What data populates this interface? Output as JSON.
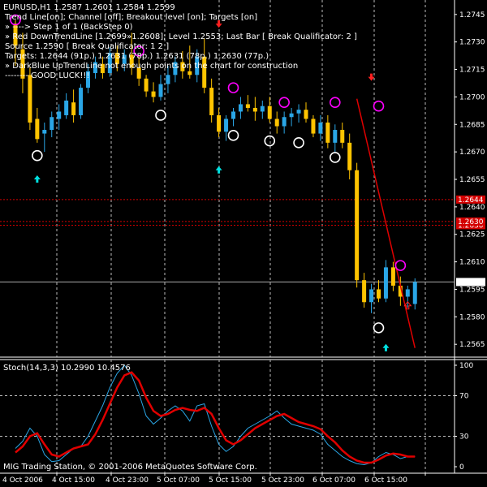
{
  "header": {
    "symbol_line": "EURUSD,H1  1.2587 1.2601 1.2584 1.2599",
    "status_line": "Trend Line[on]; Channel [off]; Breakout level [on]; Targets [on]",
    "lines": [
      "» ----> Step 1 of 1 (BackStep 0)",
      "» Red DownTrendLine [1.2699»1.2608]; Level 1.2553; Last Bar [ Break Qualificator: 2 ]",
      "Source 1.2590 [ Break Qualificator: 1 2 ]",
      "Targets: 1.2644 (91p.) 1.2631 (78p.) 1.2631 (78p.) 1.2630 (77p.)",
      "» DarkBlue UpTrendLine not enough points on the chart for construction",
      "-------- GOOD LUCK!!!"
    ]
  },
  "price_axis": {
    "ticks": [
      "1.2745",
      "1.2730",
      "1.2715",
      "1.2700",
      "1.2685",
      "1.2670",
      "1.2655",
      "1.2640",
      "1.2625",
      "1.2610",
      "1.2595",
      "1.2580",
      "1.2565"
    ],
    "levels": [
      {
        "label": "1.2644",
        "value": 1.2644,
        "color": "#d40000"
      },
      {
        "label": "1.2630",
        "value": 1.263,
        "color": "#d40000"
      },
      {
        "label": "1.2630",
        "value": 1.2632,
        "color": "#d40000"
      }
    ],
    "current": {
      "label": "1.2599",
      "value": 1.2599
    }
  },
  "time_axis": {
    "labels": [
      "4 Oct 2006",
      "4 Oct 15:00",
      "4 Oct 23:00",
      "5 Oct 07:00",
      "5 Oct 15:00",
      "5 Oct 23:00",
      "6 Oct 07:00",
      "6 Oct 15:00"
    ]
  },
  "indicator": {
    "title": "Stoch(14,3,3) 10.2990 10.4576",
    "ticks": [
      "100",
      "70",
      "30",
      "0"
    ],
    "footer": "MIG Trading Station, © 2001-2006 MetaQuotes Software Corp."
  },
  "colors": {
    "bull": "#2aa6e6",
    "bear": "#ffc400",
    "trendline": "#e00000",
    "circle_low": "#ffffff",
    "circle_high": "#ff00ff",
    "arrow_up": "#00e0e0",
    "arrow_down": "#ff2020",
    "stoch_main": "#2aa6e6",
    "stoch_signal": "#e00000"
  },
  "chart_data": {
    "type": "candlestick",
    "symbol": "EURUSD",
    "timeframe": "H1",
    "ylim": [
      1.2558,
      1.2752
    ],
    "candles": [
      [
        1.274,
        1.2742,
        1.2717,
        1.2728
      ],
      [
        1.2726,
        1.2735,
        1.2702,
        1.271
      ],
      [
        1.2712,
        1.2716,
        1.2682,
        1.2686
      ],
      [
        1.2688,
        1.2694,
        1.2675,
        1.2677
      ],
      [
        1.268,
        1.2686,
        1.267,
        1.2682
      ],
      [
        1.2682,
        1.2692,
        1.2678,
        1.2689
      ],
      [
        1.2688,
        1.2696,
        1.2682,
        1.2692
      ],
      [
        1.269,
        1.2702,
        1.2688,
        1.2698
      ],
      [
        1.2697,
        1.2704,
        1.2686,
        1.269
      ],
      [
        1.269,
        1.2707,
        1.2688,
        1.2705
      ],
      [
        1.2705,
        1.2718,
        1.2702,
        1.2714
      ],
      [
        1.2713,
        1.2722,
        1.271,
        1.2719
      ],
      [
        1.2718,
        1.2722,
        1.271,
        1.2713
      ],
      [
        1.2713,
        1.2727,
        1.2711,
        1.2724
      ],
      [
        1.2724,
        1.2728,
        1.2714,
        1.2718
      ],
      [
        1.2718,
        1.2726,
        1.2714,
        1.2723
      ],
      [
        1.2723,
        1.2735,
        1.2712,
        1.2716
      ],
      [
        1.2716,
        1.2722,
        1.2706,
        1.271
      ],
      [
        1.271,
        1.2712,
        1.27,
        1.2703
      ],
      [
        1.2703,
        1.2708,
        1.2697,
        1.27
      ],
      [
        1.27,
        1.2712,
        1.2698,
        1.2707
      ],
      [
        1.2707,
        1.2717,
        1.2702,
        1.2712
      ],
      [
        1.2712,
        1.2722,
        1.2708,
        1.2719
      ],
      [
        1.2719,
        1.2725,
        1.271,
        1.2714
      ],
      [
        1.2714,
        1.2728,
        1.271,
        1.2712
      ],
      [
        1.2712,
        1.2726,
        1.2708,
        1.2722
      ],
      [
        1.2722,
        1.2732,
        1.2702,
        1.2705
      ],
      [
        1.2705,
        1.271,
        1.2686,
        1.269
      ],
      [
        1.269,
        1.2694,
        1.2678,
        1.2681
      ],
      [
        1.2681,
        1.269,
        1.2676,
        1.2688
      ],
      [
        1.2688,
        1.2694,
        1.2684,
        1.2692
      ],
      [
        1.2692,
        1.27,
        1.2688,
        1.2696
      ],
      [
        1.2696,
        1.2701,
        1.2692,
        1.2694
      ],
      [
        1.2694,
        1.27,
        1.2687,
        1.2692
      ],
      [
        1.2692,
        1.2698,
        1.2688,
        1.2695
      ],
      [
        1.2695,
        1.27,
        1.2686,
        1.2688
      ],
      [
        1.2688,
        1.2692,
        1.268,
        1.2684
      ],
      [
        1.2684,
        1.2692,
        1.268,
        1.2689
      ],
      [
        1.2689,
        1.2694,
        1.2684,
        1.2691
      ],
      [
        1.2691,
        1.2696,
        1.2686,
        1.2693
      ],
      [
        1.2693,
        1.2697,
        1.2686,
        1.2688
      ],
      [
        1.2688,
        1.269,
        1.2678,
        1.268
      ],
      [
        1.268,
        1.269,
        1.2676,
        1.2686
      ],
      [
        1.2686,
        1.269,
        1.2672,
        1.2675
      ],
      [
        1.2675,
        1.2685,
        1.267,
        1.2682
      ],
      [
        1.2682,
        1.2686,
        1.2672,
        1.2675
      ],
      [
        1.2675,
        1.268,
        1.2655,
        1.266
      ],
      [
        1.266,
        1.2664,
        1.2596,
        1.26
      ],
      [
        1.26,
        1.2604,
        1.2585,
        1.2588
      ],
      [
        1.2588,
        1.2598,
        1.2582,
        1.2595
      ],
      [
        1.2595,
        1.26,
        1.2588,
        1.259
      ],
      [
        1.259,
        1.2611,
        1.2588,
        1.2607
      ],
      [
        1.2607,
        1.261,
        1.2594,
        1.2597
      ],
      [
        1.2597,
        1.2602,
        1.2586,
        1.2591
      ],
      [
        1.2591,
        1.2597,
        1.2585,
        1.2595
      ],
      [
        1.2587,
        1.2601,
        1.2584,
        1.2599
      ]
    ],
    "trendline": {
      "from_bar": 47,
      "from_price": 1.2699,
      "to_bar": 55,
      "to_price": 1.2563
    },
    "low_markers": [
      [
        3,
        1.2668
      ],
      [
        20,
        1.269
      ],
      [
        30,
        1.2679
      ],
      [
        35,
        1.2676
      ],
      [
        39,
        1.2675
      ],
      [
        44,
        1.2667
      ],
      [
        50,
        1.2574
      ]
    ],
    "high_markers": [
      [
        0,
        1.2742
      ],
      [
        17,
        1.2725
      ],
      [
        30,
        1.2705
      ],
      [
        37,
        1.2697
      ],
      [
        44,
        1.2697
      ],
      [
        50,
        1.2695
      ],
      [
        53,
        1.2608
      ]
    ],
    "up_arrows": [
      [
        3,
        1.2655
      ],
      [
        28,
        1.266
      ],
      [
        51,
        1.2563
      ]
    ],
    "down_arrows": [
      [
        28,
        1.274
      ],
      [
        49,
        1.2711
      ]
    ],
    "hollow_up_arrow": [
      54,
      1.2586
    ],
    "stochastic": {
      "main": [
        18,
        25,
        38,
        30,
        12,
        5,
        6,
        12,
        18,
        20,
        30,
        45,
        60,
        78,
        92,
        100,
        90,
        72,
        50,
        42,
        48,
        55,
        60,
        55,
        45,
        60,
        62,
        40,
        22,
        15,
        20,
        30,
        38,
        42,
        46,
        50,
        55,
        48,
        42,
        40,
        38,
        36,
        32,
        22,
        16,
        10,
        6,
        3,
        2,
        4,
        10,
        14,
        12,
        8,
        10,
        10
      ],
      "signal": [
        14,
        20,
        30,
        33,
        22,
        12,
        10,
        14,
        18,
        20,
        22,
        32,
        46,
        62,
        78,
        90,
        93,
        85,
        68,
        55,
        50,
        52,
        56,
        58,
        56,
        55,
        58,
        52,
        38,
        26,
        22,
        26,
        32,
        38,
        42,
        46,
        50,
        52,
        48,
        44,
        42,
        40,
        37,
        30,
        24,
        16,
        10,
        6,
        4,
        4,
        7,
        11,
        13,
        12,
        10,
        10
      ],
      "ylim": [
        0,
        100
      ]
    }
  }
}
